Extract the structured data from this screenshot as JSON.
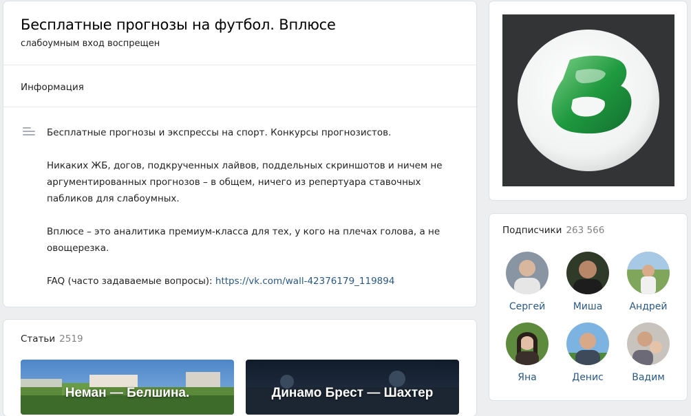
{
  "group": {
    "title": "Бесплатные прогнозы на футбол. Вплюсе",
    "status": "слабоумным вход воспрещен"
  },
  "info": {
    "heading": "Информация",
    "paragraphs": [
      "Бесплатные прогнозы и экспрессы на спорт. Конкурсы прогнозистов.",
      "Никаких ЖБ, догов, подкрученных лайвов, поддельных скриншотов и ничем не аргументированных прогнозов – в общем, ничего из репертуара ставочных пабликов для слабоумных.",
      "Вплюсе – это аналитика премиум-класса для тех, у кого на плечах голова, а не овощерезка."
    ],
    "faq_prefix": "FAQ (часто задаваемые вопросы): ",
    "faq_link": "https://vk.com/wall-42376179_119894"
  },
  "articles": {
    "heading": "Статьи",
    "count": "2519",
    "items": [
      {
        "title": "Неман — Белшина."
      },
      {
        "title": "Динамо Брест — Шахтер"
      }
    ]
  },
  "members": {
    "heading": "Подписчики",
    "count": "263 566",
    "people": [
      {
        "name": "Сергей"
      },
      {
        "name": "Миша"
      },
      {
        "name": "Андрей"
      },
      {
        "name": "Яна"
      },
      {
        "name": "Денис"
      },
      {
        "name": "Вадим"
      }
    ]
  },
  "icons": {
    "description": "lines-icon",
    "logo": "vplyuse-logo"
  },
  "colors": {
    "link": "#2a5885",
    "logo_green": "#1f9a3f",
    "avatar_bg": "#333436"
  }
}
